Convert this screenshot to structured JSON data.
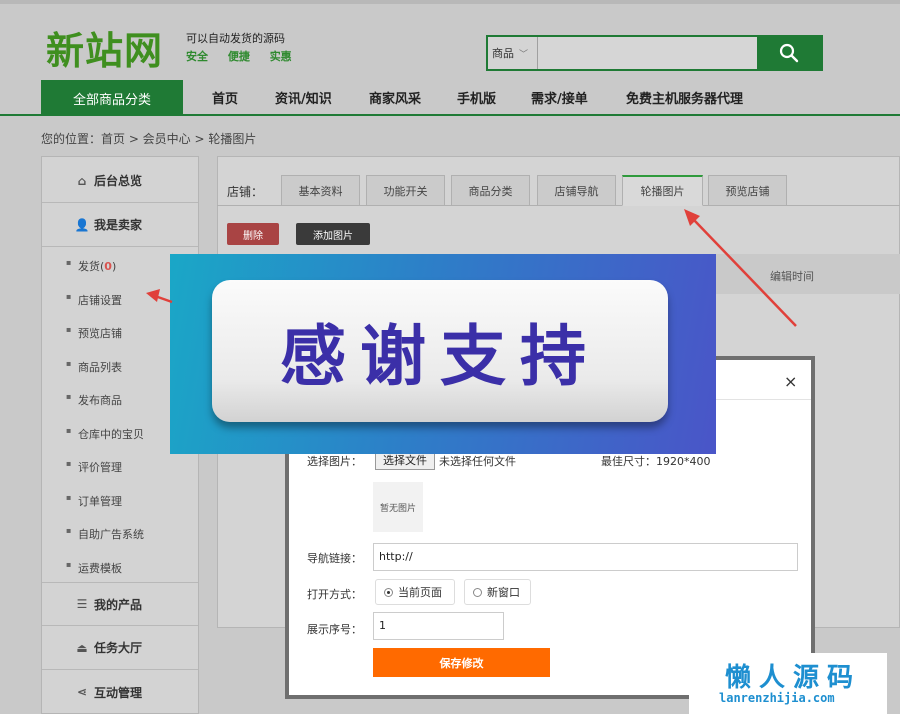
{
  "header": {
    "logo": "新站网",
    "slogan": "可以自动发货的源码",
    "slogan_tags": [
      "安全",
      "便捷",
      "实惠"
    ],
    "search_category": "商品",
    "search_value": ""
  },
  "nav": {
    "all_categories": "全部商品分类",
    "items": [
      "首页",
      "资讯/知识",
      "商家风采",
      "手机版",
      "需求/接单",
      "免费主机服务器代理"
    ]
  },
  "breadcrumb": "您的位置：首页 > 会员中心 > 轮播图片",
  "sidebar": {
    "dashboard": "后台总览",
    "seller": "我是卖家",
    "sub_ship_label": "发货(",
    "sub_ship_count": "0",
    "sub_ship_close": ")",
    "sub_items": [
      "店铺设置",
      "预览店铺",
      "商品列表",
      "发布商品",
      "仓库中的宝贝",
      "评价管理",
      "订单管理",
      "自助广告系统",
      "运费模板"
    ],
    "products": "我的产品",
    "tasks": "任务大厅",
    "interaction": "互动管理"
  },
  "main": {
    "tabs_label": "店铺：",
    "tabs": [
      "基本资料",
      "功能开关",
      "商品分类",
      "店铺导航",
      "轮播图片",
      "预览店铺"
    ],
    "active_tab": "轮播图片",
    "delete_button": "删除",
    "add_button": "添加图片",
    "col_edit_time": "编辑时间"
  },
  "modal": {
    "close_symbol": "×",
    "image_label": "选择图片：",
    "file_button": "选择文件",
    "file_status": "未选择任何文件",
    "size_hint": "最佳尺寸：1920*400",
    "no_image": "暂无图片",
    "link_label": "导航链接：",
    "link_value": "http://",
    "open_label": "打开方式：",
    "open_current": "当前页面",
    "open_new": "新窗口",
    "order_label": "展示序号：",
    "order_value": "1",
    "save_button": "保存修改"
  },
  "banner": {
    "text": "感谢支持"
  },
  "watermark": {
    "cn": "懒人源码",
    "en": "lanrenzhijia.com"
  },
  "colors": {
    "brand_green": "#1f7a35",
    "logo_green": "#3f8f1f",
    "save_orange": "#ff6a00",
    "delete_red": "#a94444",
    "arrow_red": "#e0403a",
    "banner_text": "#3b2fa8",
    "watermark_blue": "#1e8fd0"
  }
}
